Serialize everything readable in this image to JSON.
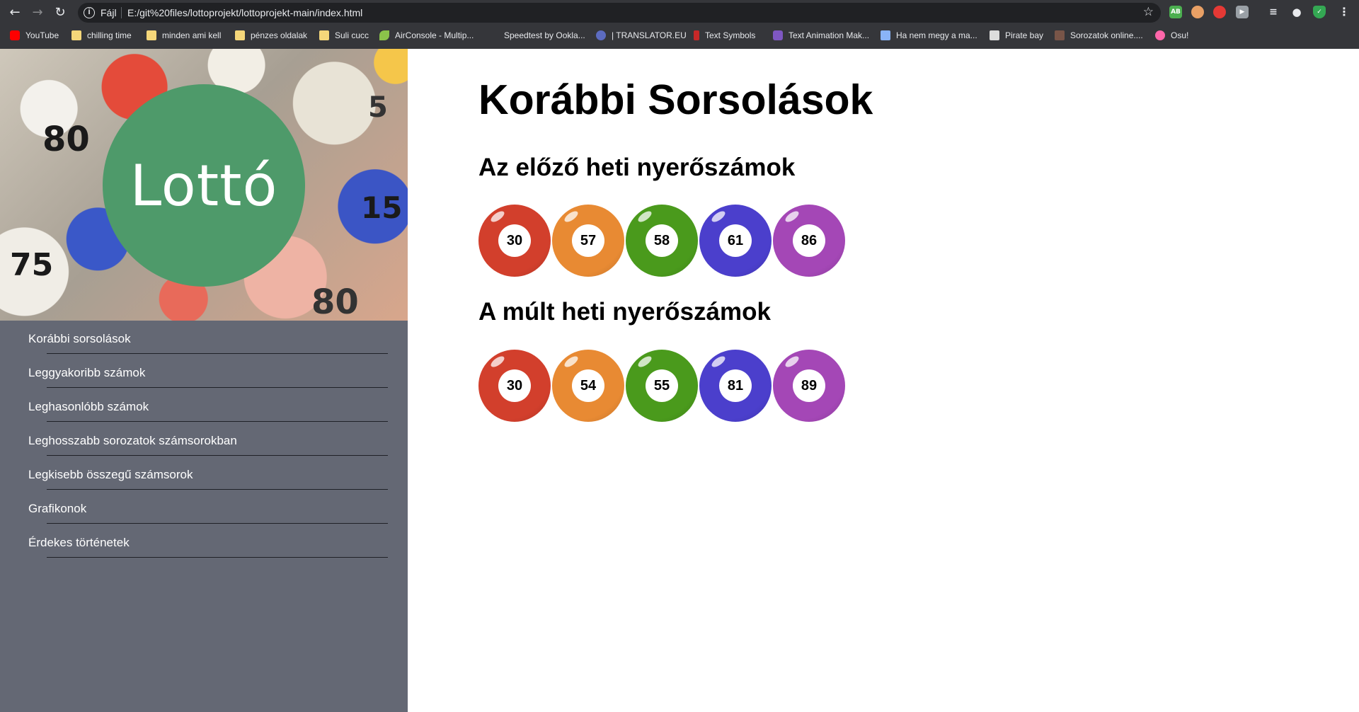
{
  "browser": {
    "scheme_label": "Fájl",
    "url": "E:/git%20files/lottoprojekt/lottoprojekt-main/index.html",
    "bookmarks": [
      {
        "label": "YouTube",
        "icon": "youtube-icon"
      },
      {
        "label": "chilling time",
        "icon": "folder-icon"
      },
      {
        "label": "minden ami kell",
        "icon": "folder-icon"
      },
      {
        "label": "pénzes oldalak",
        "icon": "folder-icon"
      },
      {
        "label": "Suli cucc",
        "icon": "folder-icon"
      },
      {
        "label": "AirConsole - Multip...",
        "icon": "airconsole-icon"
      },
      {
        "label": "Speedtest by Ookla...",
        "icon": "speedtest-icon"
      },
      {
        "label": "| TRANSLATOR.EU",
        "icon": "translator-icon"
      },
      {
        "label": "Text Symbols",
        "icon": "text-symbols-icon"
      },
      {
        "label": "Text Animation Mak...",
        "icon": "text-animation-icon"
      },
      {
        "label": "Ha nem megy a ma...",
        "icon": "c-icon"
      },
      {
        "label": "Pirate bay",
        "icon": "pirate-bay-icon"
      },
      {
        "label": "Sorozatok online....",
        "icon": "sb-icon"
      },
      {
        "label": "Osu!",
        "icon": "osu-icon"
      }
    ]
  },
  "sidebar": {
    "logo_text": "Lottó",
    "menu": [
      {
        "label": "Korábbi sorsolások"
      },
      {
        "label": "Leggyakoribb számok"
      },
      {
        "label": "Leghasonlóbb számok"
      },
      {
        "label": "Leghosszabb sorozatok számsorokban"
      },
      {
        "label": "Legkisebb összegű számsorok"
      },
      {
        "label": "Grafikonok"
      },
      {
        "label": "Érdekes történetek"
      }
    ]
  },
  "main": {
    "title": "Korábbi Sorsolások",
    "sections": [
      {
        "title": "Az előző heti nyerőszámok",
        "numbers": [
          "30",
          "57",
          "58",
          "61",
          "86"
        ]
      },
      {
        "title": "A múlt heti nyerőszámok",
        "numbers": [
          "30",
          "54",
          "55",
          "81",
          "89"
        ]
      }
    ]
  },
  "colors": {
    "ball_colors": [
      "#d23f2c",
      "#e88a33",
      "#4a9a1c",
      "#4b3fcc",
      "#a447b6"
    ],
    "sidebar_bg": "#646874",
    "logo_bg": "#4e9a6a"
  }
}
